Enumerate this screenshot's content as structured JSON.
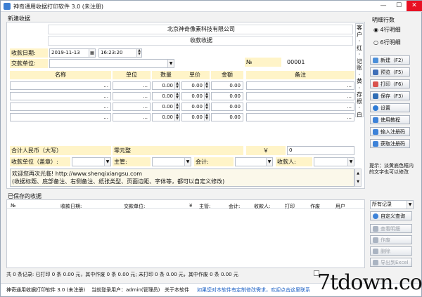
{
  "window": {
    "title": "神奇通用收据打印软件 3.0 (未注册)",
    "min": "—",
    "max": "☐",
    "close": "✕"
  },
  "new_receipt": {
    "group_label": "新建收据",
    "company": "北京神奇像素科技有限公司",
    "doc_title": "收款收据",
    "date_label": "收款日期:",
    "date_value": "2019-11-13",
    "time_value": "16:23:20",
    "no_label": "№",
    "no_value": "00001",
    "payer_label": "交款单位:",
    "payer_value": "",
    "columns": [
      "名称",
      "单位",
      "数量",
      "单价",
      "金额",
      "备注"
    ],
    "rows": [
      {
        "name": "...",
        "unit": "...",
        "qty": "0.00",
        "price": "0.00",
        "amount": "0.00",
        "note": "..."
      },
      {
        "name": "...",
        "unit": "...",
        "qty": "0.00",
        "price": "0.00",
        "amount": "0.00",
        "note": "..."
      },
      {
        "name": "...",
        "unit": "...",
        "qty": "0.00",
        "price": "0.00",
        "amount": "0.00",
        "note": "..."
      },
      {
        "name": "...",
        "unit": "...",
        "qty": "0.00",
        "price": "0.00",
        "amount": "0.00",
        "note": "..."
      }
    ],
    "total_cn_label": "合计人民币（大写）",
    "total_cn_value": "零元整",
    "yen": "￥",
    "total_value": "0",
    "receiver_unit_label": "收款单位（盖章）:",
    "supervisor_label": "主管:",
    "accountant_label": "会计:",
    "cashier_label": "收款人:",
    "footer_text_1": "欢迎您再次光临! http://www.shenqixiangsu.com",
    "footer_text_2": "(收据标题、底部备注、右侧备注、纸张类型、页面边距、字体等，都可以自定义修改)",
    "side_note": [
      "客",
      "户",
      "·",
      "红",
      "·",
      "记",
      "账",
      "·",
      "黄",
      "·",
      "存",
      "根",
      "·",
      "白"
    ]
  },
  "right_panel": {
    "rows_label": "明细行数",
    "opt4": "4行明细",
    "opt6": "6行明细",
    "buttons": [
      {
        "label": "新建（F2）",
        "icon": "new-icon",
        "color": "#4b8fd9"
      },
      {
        "label": "预览（F5）",
        "icon": "preview-icon",
        "color": "#3f6fb8"
      },
      {
        "label": "打印（F6）",
        "icon": "print-icon",
        "color": "#d9534f"
      },
      {
        "label": "保存（F3）",
        "icon": "save-icon",
        "color": "#2f6db5"
      },
      {
        "label": "设置",
        "icon": "gear-icon",
        "color": "#2d7bd6"
      },
      {
        "label": "使用教程",
        "icon": "tutorial-icon",
        "color": "#3d82d8"
      },
      {
        "label": "输入注册码",
        "icon": "key-icon",
        "color": "#3d82d8"
      },
      {
        "label": "获取注册码",
        "icon": "get-key-icon",
        "color": "#3d82d8"
      }
    ],
    "tip": [
      "提示：淡黄底色框内",
      "的文字也可以修改"
    ]
  },
  "saved": {
    "group_label": "已保存的收据",
    "columns": [
      "№",
      "收款日期:",
      "交款单位:",
      "¥",
      "主管:",
      "会计:",
      "收款人:",
      "打印",
      "作废",
      "用户"
    ],
    "filter": "所有记录",
    "buttons": [
      {
        "label": "自定义查询",
        "icon": "query-icon",
        "disabled": false
      },
      {
        "label": "查看明细",
        "icon": "detail-icon",
        "disabled": true
      },
      {
        "label": "作废",
        "icon": "void-icon",
        "disabled": true
      },
      {
        "label": "删除",
        "icon": "delete-icon",
        "disabled": true
      },
      {
        "label": "导出到Excel",
        "icon": "excel-icon",
        "disabled": true
      }
    ]
  },
  "summary": "共 0 条记录:   已打印 0 条 0.00 元，其中作废 0 条 0.00 元;   未打印 0 条 0.00 元，其中作废 0 条 0.00 元",
  "statusbar": {
    "app": "神奇通用收据打印软件 3.0 (未注册)",
    "user": "当前登录用户：admin(管理员)",
    "about": "关于本软件",
    "notice": "如果您对本软件有定制修改需求，欢迎点击这里联系",
    "watermark": "7tdown.com"
  }
}
